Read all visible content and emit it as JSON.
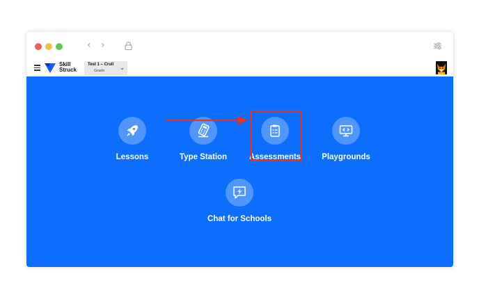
{
  "window": {
    "traffic_lights": [
      "close",
      "minimize",
      "maximize"
    ],
    "nav": {
      "back_icon": "chevron-left-icon",
      "forward_icon": "chevron-right-icon",
      "back_glyph": "‹",
      "forward_glyph": "›"
    }
  },
  "appbar": {
    "brand": {
      "line1": "Skill",
      "line2": "Struck"
    },
    "class_select": {
      "name": "Test 1 – Crull",
      "sub": "Grade",
      "chevron": "⌄"
    }
  },
  "tiles": [
    {
      "label": "Lessons",
      "icon": "rocket-icon"
    },
    {
      "label": "Type Station",
      "icon": "calculator-icon"
    },
    {
      "label": "Assessments",
      "icon": "clipboard-icon"
    },
    {
      "label": "Playgrounds",
      "icon": "monitor-code-icon"
    },
    {
      "label": "Chat for Schools",
      "icon": "chat-lightning-icon"
    }
  ],
  "annotation": {
    "highlighted_tile": "Assessments",
    "color": "#e53423"
  },
  "colors": {
    "main_bg": "#0d6efd",
    "brand_blue": "#1a5cff"
  }
}
